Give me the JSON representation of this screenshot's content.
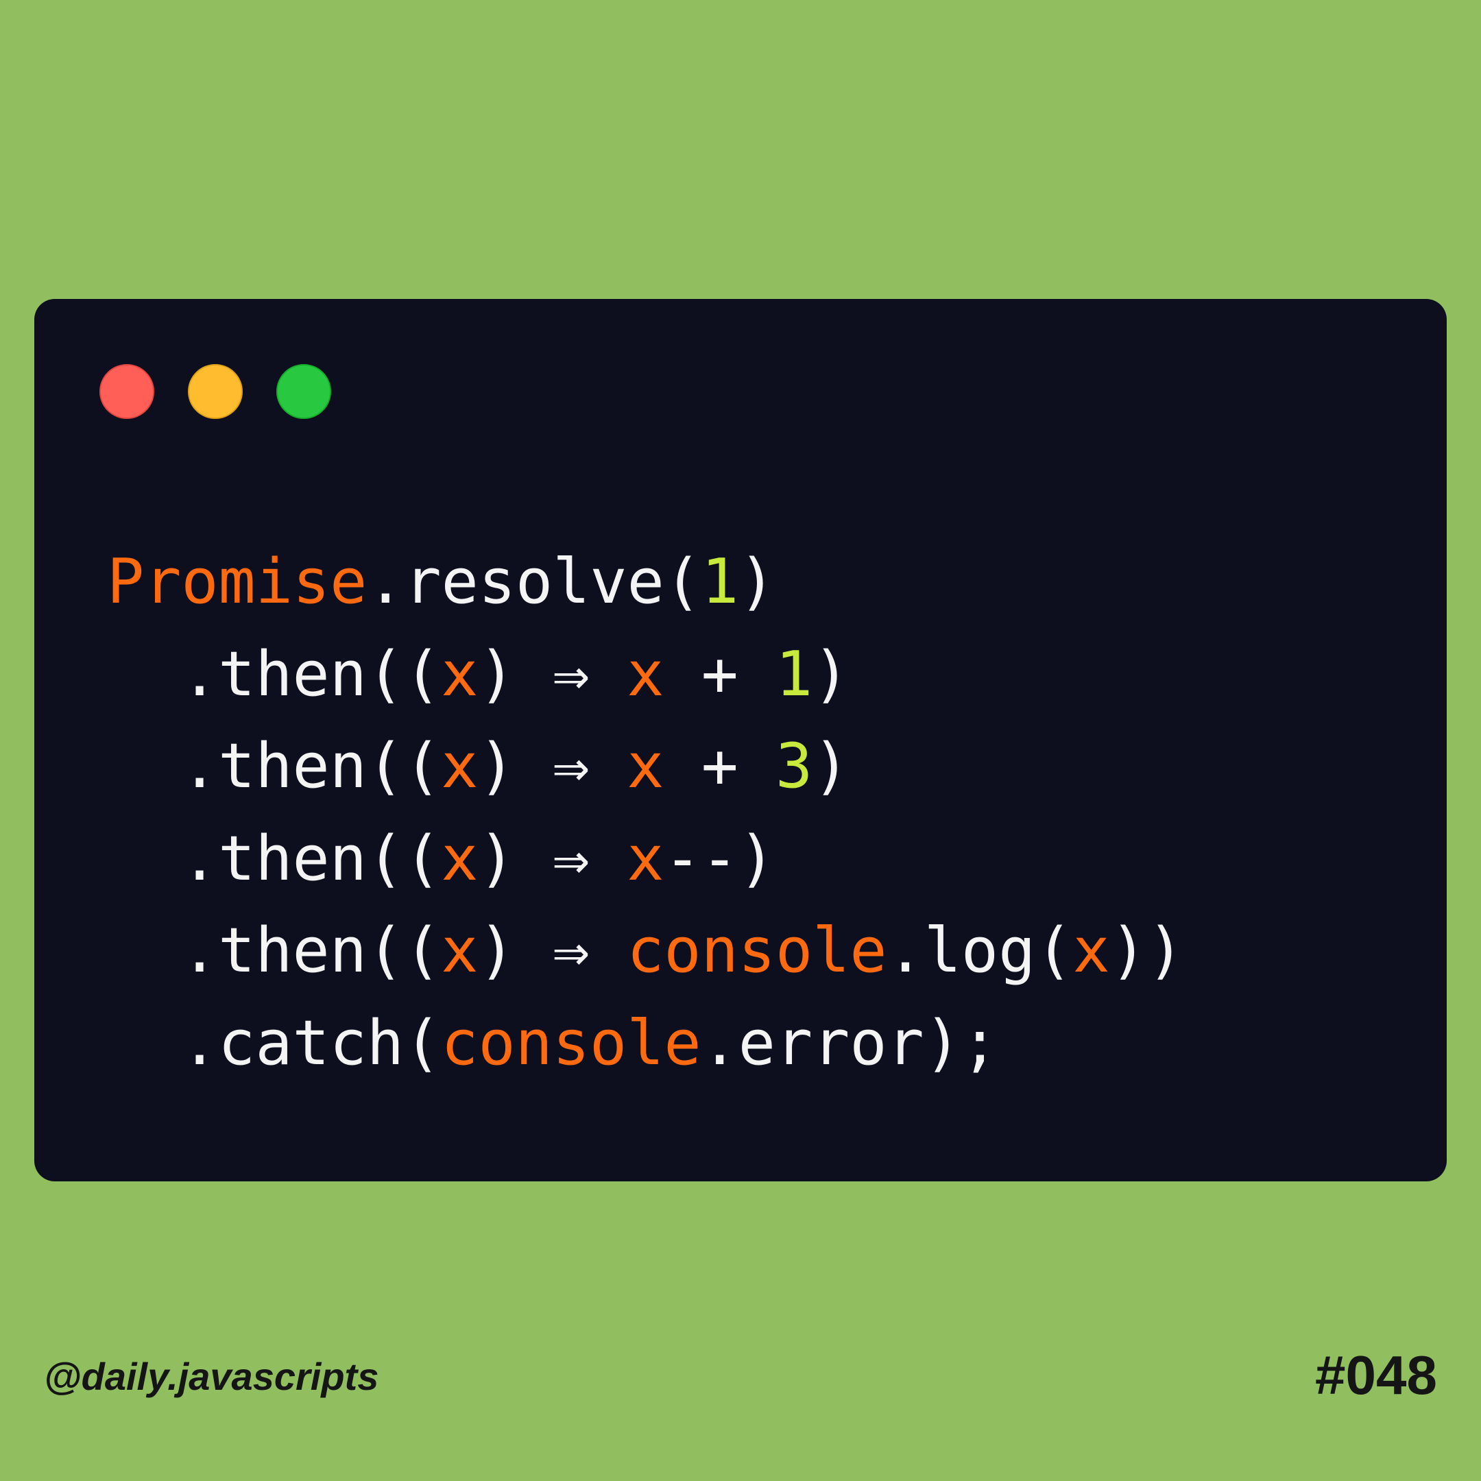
{
  "window": {
    "controls": [
      {
        "name": "close",
        "color": "#ff5f57"
      },
      {
        "name": "minimize",
        "color": "#febc2e"
      },
      {
        "name": "maximize",
        "color": "#28c840"
      }
    ]
  },
  "code": {
    "lines": [
      {
        "indent": false,
        "tokens": [
          {
            "t": "Promise",
            "k": "obj"
          },
          {
            "t": ".resolve(",
            "k": "plain"
          },
          {
            "t": "1",
            "k": "num"
          },
          {
            "t": ")",
            "k": "plain"
          }
        ]
      },
      {
        "indent": true,
        "tokens": [
          {
            "t": ".then((",
            "k": "plain"
          },
          {
            "t": "x",
            "k": "param"
          },
          {
            "t": ") ⇒ ",
            "k": "plain"
          },
          {
            "t": "x",
            "k": "param"
          },
          {
            "t": " + ",
            "k": "plain"
          },
          {
            "t": "1",
            "k": "num"
          },
          {
            "t": ")",
            "k": "plain"
          }
        ]
      },
      {
        "indent": true,
        "tokens": [
          {
            "t": ".then((",
            "k": "plain"
          },
          {
            "t": "x",
            "k": "param"
          },
          {
            "t": ") ⇒ ",
            "k": "plain"
          },
          {
            "t": "x",
            "k": "param"
          },
          {
            "t": " + ",
            "k": "plain"
          },
          {
            "t": "3",
            "k": "num"
          },
          {
            "t": ")",
            "k": "plain"
          }
        ]
      },
      {
        "indent": true,
        "tokens": [
          {
            "t": ".then((",
            "k": "plain"
          },
          {
            "t": "x",
            "k": "param"
          },
          {
            "t": ") ⇒ ",
            "k": "plain"
          },
          {
            "t": "x",
            "k": "param"
          },
          {
            "t": "--)",
            "k": "plain"
          }
        ]
      },
      {
        "indent": true,
        "tokens": [
          {
            "t": ".then((",
            "k": "plain"
          },
          {
            "t": "x",
            "k": "param"
          },
          {
            "t": ") ⇒ ",
            "k": "plain"
          },
          {
            "t": "console",
            "k": "obj"
          },
          {
            "t": ".log(",
            "k": "plain"
          },
          {
            "t": "x",
            "k": "param"
          },
          {
            "t": "))",
            "k": "plain"
          }
        ]
      },
      {
        "indent": true,
        "tokens": [
          {
            "t": ".catch(",
            "k": "plain"
          },
          {
            "t": "console",
            "k": "obj"
          },
          {
            "t": ".error);",
            "k": "plain"
          }
        ]
      }
    ]
  },
  "footer": {
    "handle": "@daily.javascripts",
    "issue": "#048"
  },
  "colors": {
    "background": "#91bf60",
    "card": "#0d0f1f",
    "keyword": "#ff6a10",
    "number": "#c8ea3c",
    "text": "#f4f4f4"
  }
}
